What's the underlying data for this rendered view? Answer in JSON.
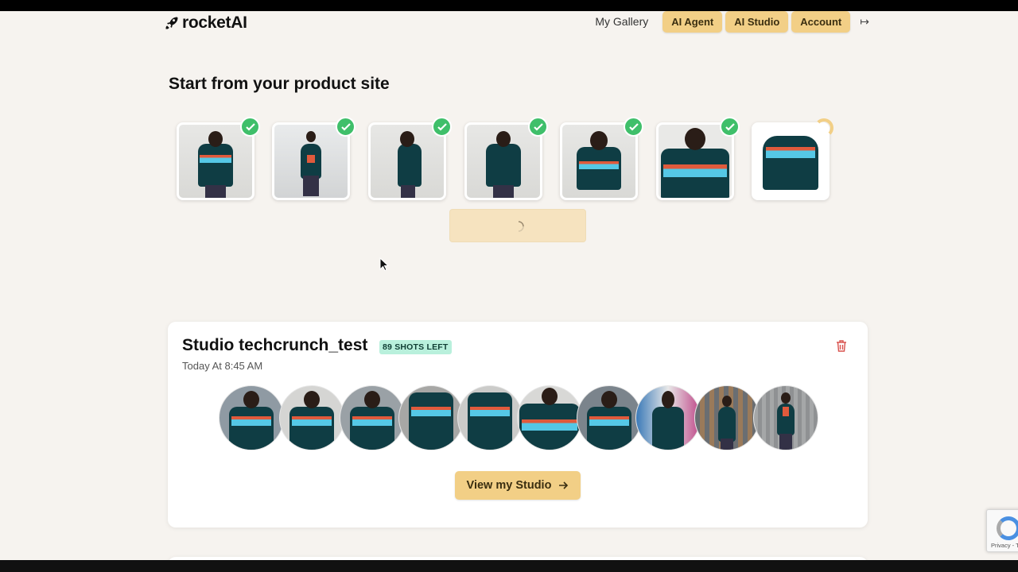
{
  "header": {
    "logo_text": "rocketAI",
    "nav": {
      "gallery": "My Gallery",
      "agent": "AI Agent",
      "studio": "AI Studio",
      "account": "Account",
      "logout": "↦"
    }
  },
  "product_section": {
    "title": "Start from your product site",
    "thumbnails": [
      {
        "icon": "check-icon",
        "status": "done"
      },
      {
        "icon": "check-icon",
        "status": "done"
      },
      {
        "icon": "check-icon",
        "status": "done"
      },
      {
        "icon": "check-icon",
        "status": "done"
      },
      {
        "icon": "check-icon",
        "status": "done"
      },
      {
        "icon": "check-icon",
        "status": "done"
      },
      {
        "icon": "spinner-icon",
        "status": "loading"
      }
    ]
  },
  "studio_card": {
    "title": "Studio techcrunch_test",
    "badge": "89 SHOTS LEFT",
    "timestamp": "Today At 8:45 AM",
    "view_button": "View my Studio",
    "shot_count": 10
  },
  "recaptcha": {
    "text": "Privacy - T"
  },
  "colors": {
    "accent": "#f2cf86",
    "background": "#f6f3ef",
    "badge_bg": "#b9f0dc",
    "check_green": "#3fbf6a",
    "trash_red": "#d9534f"
  }
}
